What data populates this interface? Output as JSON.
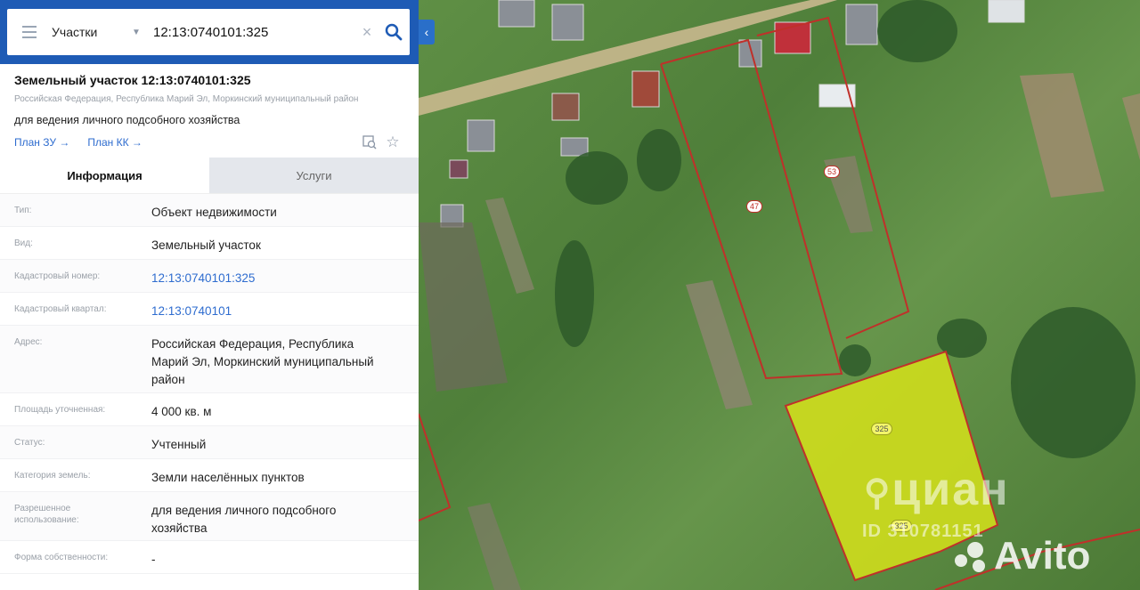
{
  "search": {
    "layer": "Участки",
    "query": "12:13:0740101:325"
  },
  "object": {
    "title": "Земельный участок 12:13:0740101:325",
    "sub_address": "Российская Федерация, Республика Марий Эл, Моркинский муниципальный район",
    "purpose": "для ведения личного подсобного хозяйства",
    "link_plan_zu": "План ЗУ →",
    "link_plan_kk": "План КК →"
  },
  "tabs": {
    "info": "Информация",
    "services": "Услуги"
  },
  "rows": [
    {
      "label": "Тип:",
      "value": "Объект недвижимости"
    },
    {
      "label": "Вид:",
      "value": "Земельный участок"
    },
    {
      "label": "Кадастровый номер:",
      "value": "12:13:0740101:325"
    },
    {
      "label": "Кадастровый квартал:",
      "value": "12:13:0740101"
    },
    {
      "label": "Адрес:",
      "value": "Российская Федерация, Республика Марий Эл, Моркинский муниципальный район"
    },
    {
      "label": "Площадь уточненная:",
      "value": "4 000 кв. м"
    },
    {
      "label": "Статус:",
      "value": "Учтенный"
    },
    {
      "label": "Категория земель:",
      "value": "Земли населённых пунктов"
    },
    {
      "label": "Разрешенное использование:",
      "value": "для ведения личного подсобного хозяйства"
    },
    {
      "label": "Форма собственности:",
      "value": "-"
    }
  ],
  "map": {
    "parcel_labels": [
      "53",
      "47",
      "325",
      "325"
    ],
    "watermark_cian": "циан",
    "watermark_id": "ID 310781151",
    "watermark_avito": "Avito"
  },
  "colors": {
    "header_blue": "#1e5bb5",
    "link_blue": "#2e6ccf",
    "parcel_fill": "#d6e21a",
    "parcel_border": "#c0302a"
  }
}
